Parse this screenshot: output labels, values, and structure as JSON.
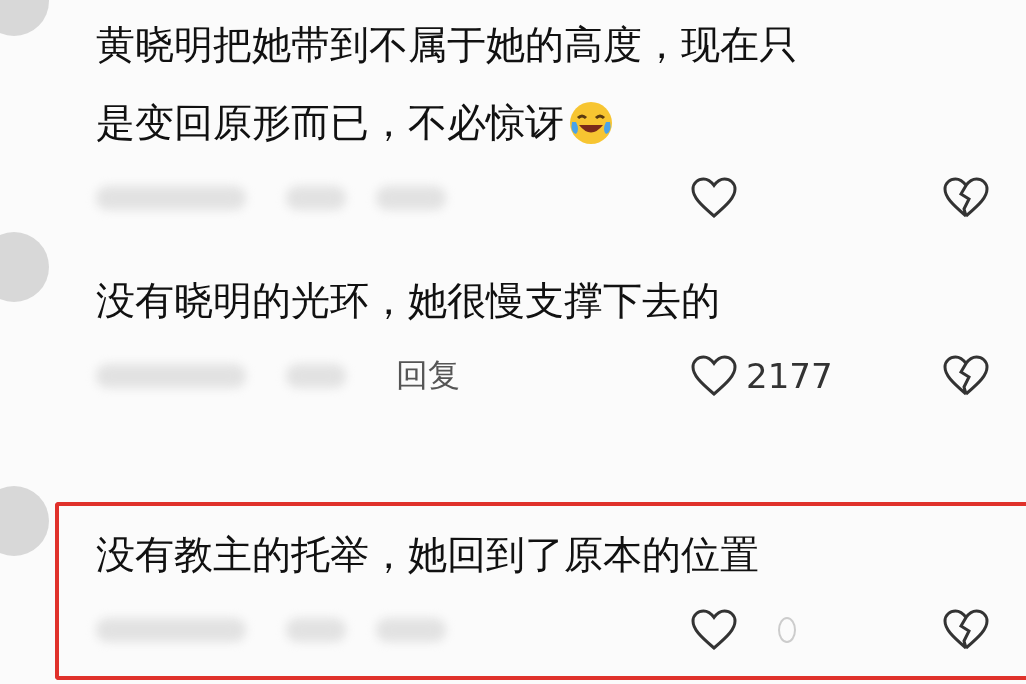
{
  "comments": [
    {
      "lines": [
        "黄晓明把她带到不属于她的高度，现在只",
        "是变回原形而已，不必惊讶"
      ],
      "has_emoji": true,
      "highlighted": false
    },
    {
      "lines": [
        "没有晓明的光环，她很慢支撑下去的"
      ],
      "has_emoji": false,
      "reply_label": "回复",
      "like_count": "2177",
      "highlighted": false
    },
    {
      "lines": [
        "没有教主的托举，她回到了原本的位置"
      ],
      "has_emoji": false,
      "highlighted": true
    }
  ]
}
